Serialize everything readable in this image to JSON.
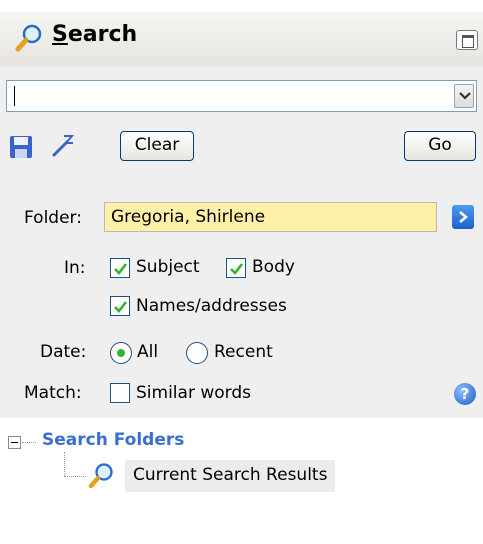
{
  "pane": {
    "title": "Search",
    "title_first_letter": "S",
    "title_rest": "earch"
  },
  "search": {
    "value": ""
  },
  "toolbar": {
    "clear_label": "Clear",
    "go_label": "Go"
  },
  "filters": {
    "folder_label": "Folder:",
    "folder_value": "Gregoria, Shirlene",
    "in_label": "In:",
    "subject_label": "Subject",
    "subject_checked": true,
    "body_label": "Body",
    "body_checked": true,
    "names_label": "Names/addresses",
    "names_checked": true,
    "date_label": "Date:",
    "date_all_label": "All",
    "date_recent_label": "Recent",
    "date_selected": "All",
    "match_label": "Match:",
    "similar_label": "Similar words",
    "similar_checked": false
  },
  "tree": {
    "group_label": "Search Folders",
    "item_label": "Current Search Results"
  },
  "colors": {
    "pane_bg": "#efefef",
    "folder_highlight": "#fff0a8",
    "tree_group": "#3a6fd0",
    "check_green": "#2fb52f"
  },
  "icons": [
    "magnifier-icon",
    "restore-icon",
    "chevron-down-icon",
    "save-icon",
    "wand-icon",
    "arrow-right-icon",
    "help-icon",
    "tree-collapse-icon"
  ]
}
